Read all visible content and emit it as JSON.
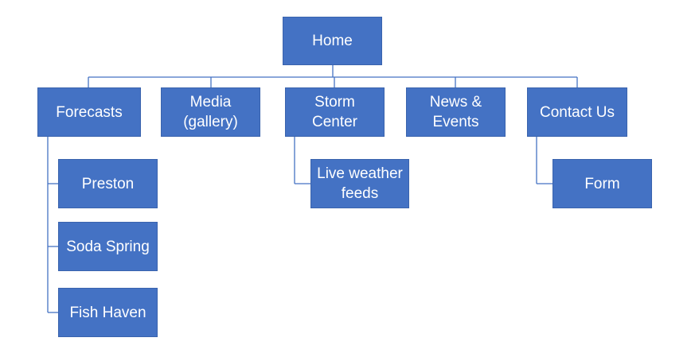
{
  "diagram": {
    "type": "sitemap",
    "line_color": "#4472c4",
    "box_color": "#4472c4",
    "text_color": "#ffffff",
    "nodes": {
      "home": "Home",
      "forecasts": "Forecasts",
      "media": "Media\n(gallery)",
      "storm_center": "Storm\nCenter",
      "news_events": "News  &\nEvents",
      "contact_us": "Contact Us",
      "preston": "Preston",
      "soda_spring": "Soda Spring",
      "fish_haven": "Fish Haven",
      "live_weather_feeds": "Live weather\nfeeds",
      "form": "Form"
    }
  }
}
